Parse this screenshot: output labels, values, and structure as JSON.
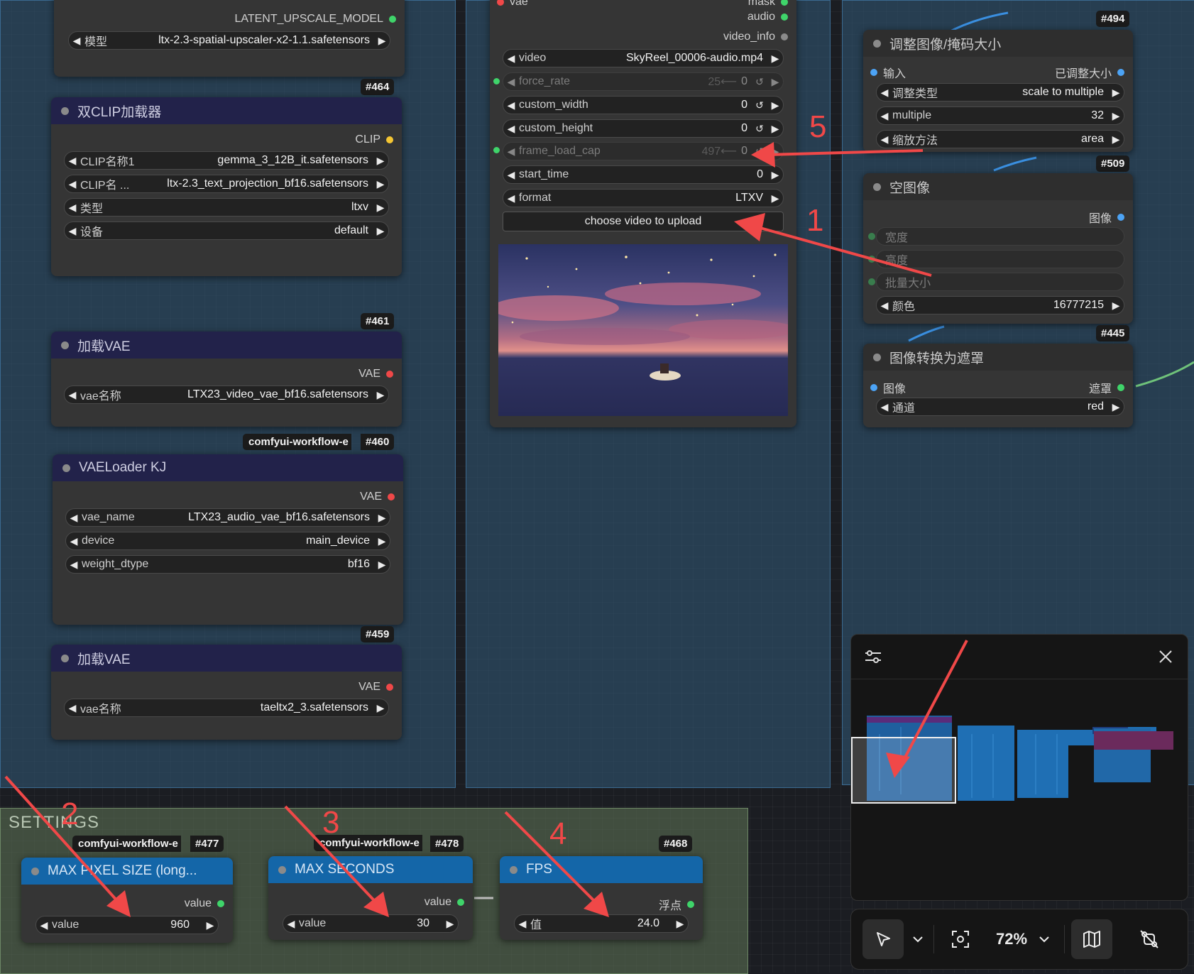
{
  "nodes": {
    "upscale_model": {
      "output_label": "LATENT_UPSCALE_MODEL",
      "widget_label": "模型",
      "widget_value": "ltx-2.3-spatial-upscaler-x2-1.1.safetensors",
      "id": "#464"
    },
    "dual_clip": {
      "title": "双CLIP加载器",
      "output_label": "CLIP",
      "widgets": [
        {
          "label": "CLIP名称1",
          "value": "gemma_3_12B_it.safetensors"
        },
        {
          "label": "CLIP名 ...",
          "value": "ltx-2.3_text_projection_bf16.safetensors"
        },
        {
          "label": "类型",
          "value": "ltxv"
        },
        {
          "label": "设备",
          "value": "default"
        }
      ],
      "id": "#461"
    },
    "load_vae_1": {
      "title": "加载VAE",
      "output_label": "VAE",
      "widget_label": "vae名称",
      "widget_value": "LTX23_video_vae_bf16.safetensors",
      "tag": "comfyui-workflow-e",
      "id": "#460"
    },
    "vae_loader_kj": {
      "title": "VAELoader KJ",
      "output_label": "VAE",
      "widgets": [
        {
          "label": "vae_name",
          "value": "LTX23_audio_vae_bf16.safetensors"
        },
        {
          "label": "device",
          "value": "main_device"
        },
        {
          "label": "weight_dtype",
          "value": "bf16"
        }
      ],
      "id": "#459"
    },
    "load_vae_2": {
      "title": "加载VAE",
      "output_label": "VAE",
      "widget_label": "vae名称",
      "widget_value": "taeltx2_3.safetensors"
    },
    "video_loader": {
      "top_labels": [
        "vae",
        "mask"
      ],
      "outputs": [
        "audio",
        "video_info"
      ],
      "widgets": [
        {
          "label": "video",
          "value": "SkyReel_00006-audio.mp4",
          "disabled": false
        },
        {
          "label": "force_rate",
          "value": "0",
          "hint": "25⟵",
          "disabled": true
        },
        {
          "label": "custom_width",
          "value": "0",
          "disabled": false
        },
        {
          "label": "custom_height",
          "value": "0",
          "disabled": false
        },
        {
          "label": "frame_load_cap",
          "value": "0",
          "hint": "497⟵",
          "disabled": true
        },
        {
          "label": "start_time",
          "value": "0",
          "disabled": false
        },
        {
          "label": "format",
          "value": "LTXV",
          "disabled": false
        }
      ],
      "upload_button": "choose video to upload"
    },
    "resize_image": {
      "id_above": "#494",
      "title": "调整图像/掩码大小",
      "input_label": "输入",
      "output_label": "已调整大小",
      "widgets": [
        {
          "label": "调整类型",
          "value": "scale to multiple"
        },
        {
          "label": "multiple",
          "value": "32"
        },
        {
          "label": "缩放方法",
          "value": "area"
        }
      ],
      "id": "#509"
    },
    "empty_image": {
      "title": "空图像",
      "output_label": "图像",
      "inputs": [
        "宽度",
        "高度",
        "批量大小"
      ],
      "color_label": "颜色",
      "color_value": "16777215",
      "id": "#445"
    },
    "image_to_mask": {
      "title": "图像转换为遮罩",
      "input_label": "图像",
      "output_label": "遮罩",
      "widget_label": "通道",
      "widget_value": "red"
    },
    "max_pixel": {
      "tag": "comfyui-workflow-e",
      "id": "#477",
      "title": "MAX PIXEL SIZE (long...",
      "output_label": "value",
      "widget_label": "value",
      "widget_value": "960"
    },
    "max_seconds": {
      "tag": "comfyui-workflow-e",
      "id": "#478",
      "title": "MAX SECONDS",
      "output_label": "value",
      "widget_label": "value",
      "widget_value": "30"
    },
    "fps": {
      "id": "#468",
      "title": "FPS",
      "output_label": "浮点",
      "widget_label": "值",
      "widget_value": "24.0"
    }
  },
  "settings_group": {
    "title": "SETTINGS"
  },
  "annotations": [
    "1",
    "2",
    "3",
    "4",
    "5"
  ],
  "toolbar": {
    "zoom": "72%"
  },
  "icons": {
    "minimap_settings": "sliders-icon",
    "minimap_close": "close-icon",
    "select_tool": "pointer-icon",
    "fit_view": "focus-icon",
    "minimap_toggle": "map-icon",
    "link_toggle": "link-off-icon"
  },
  "colors": {
    "annotation": "#f04848",
    "node_header": "#22224a",
    "primitive_header": "#1466a8",
    "group_blue": "#2f526e",
    "group_green": "#607658"
  }
}
